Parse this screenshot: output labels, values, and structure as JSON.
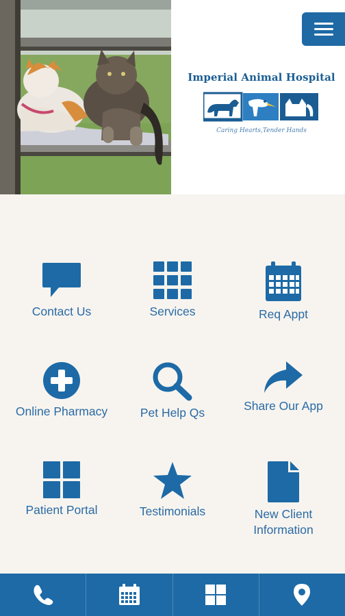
{
  "app": {
    "brand": {
      "name": "Imperial Animal Hospital",
      "tagline": "Caring Hearts,Tender Hands"
    },
    "header": {
      "photo_alt": "Two cats lounging on a window perch",
      "menu_icon": "hamburger-menu-icon"
    },
    "grid": [
      {
        "label": "Contact Us",
        "icon": "chat-bubble-icon"
      },
      {
        "label": "Services",
        "icon": "grid-icon"
      },
      {
        "label": "Req Appt",
        "icon": "calendar-icon"
      },
      {
        "label": "Online Pharmacy",
        "icon": "plus-circle-icon"
      },
      {
        "label": "Pet Help Qs",
        "icon": "search-icon"
      },
      {
        "label": "Share Our App",
        "icon": "share-arrow-icon"
      },
      {
        "label": "Patient Portal",
        "icon": "windows-icon"
      },
      {
        "label": "Testimonials",
        "icon": "star-icon"
      },
      {
        "label": "New Client Information",
        "icon": "document-icon"
      }
    ],
    "bottom_nav": [
      {
        "icon": "phone-icon"
      },
      {
        "icon": "calendar-icon"
      },
      {
        "icon": "windows-icon"
      },
      {
        "icon": "map-pin-icon"
      }
    ],
    "colors": {
      "primary": "#1d6aa6",
      "background": "#f7f4ef",
      "label_blue": "#2a6aa5"
    }
  }
}
